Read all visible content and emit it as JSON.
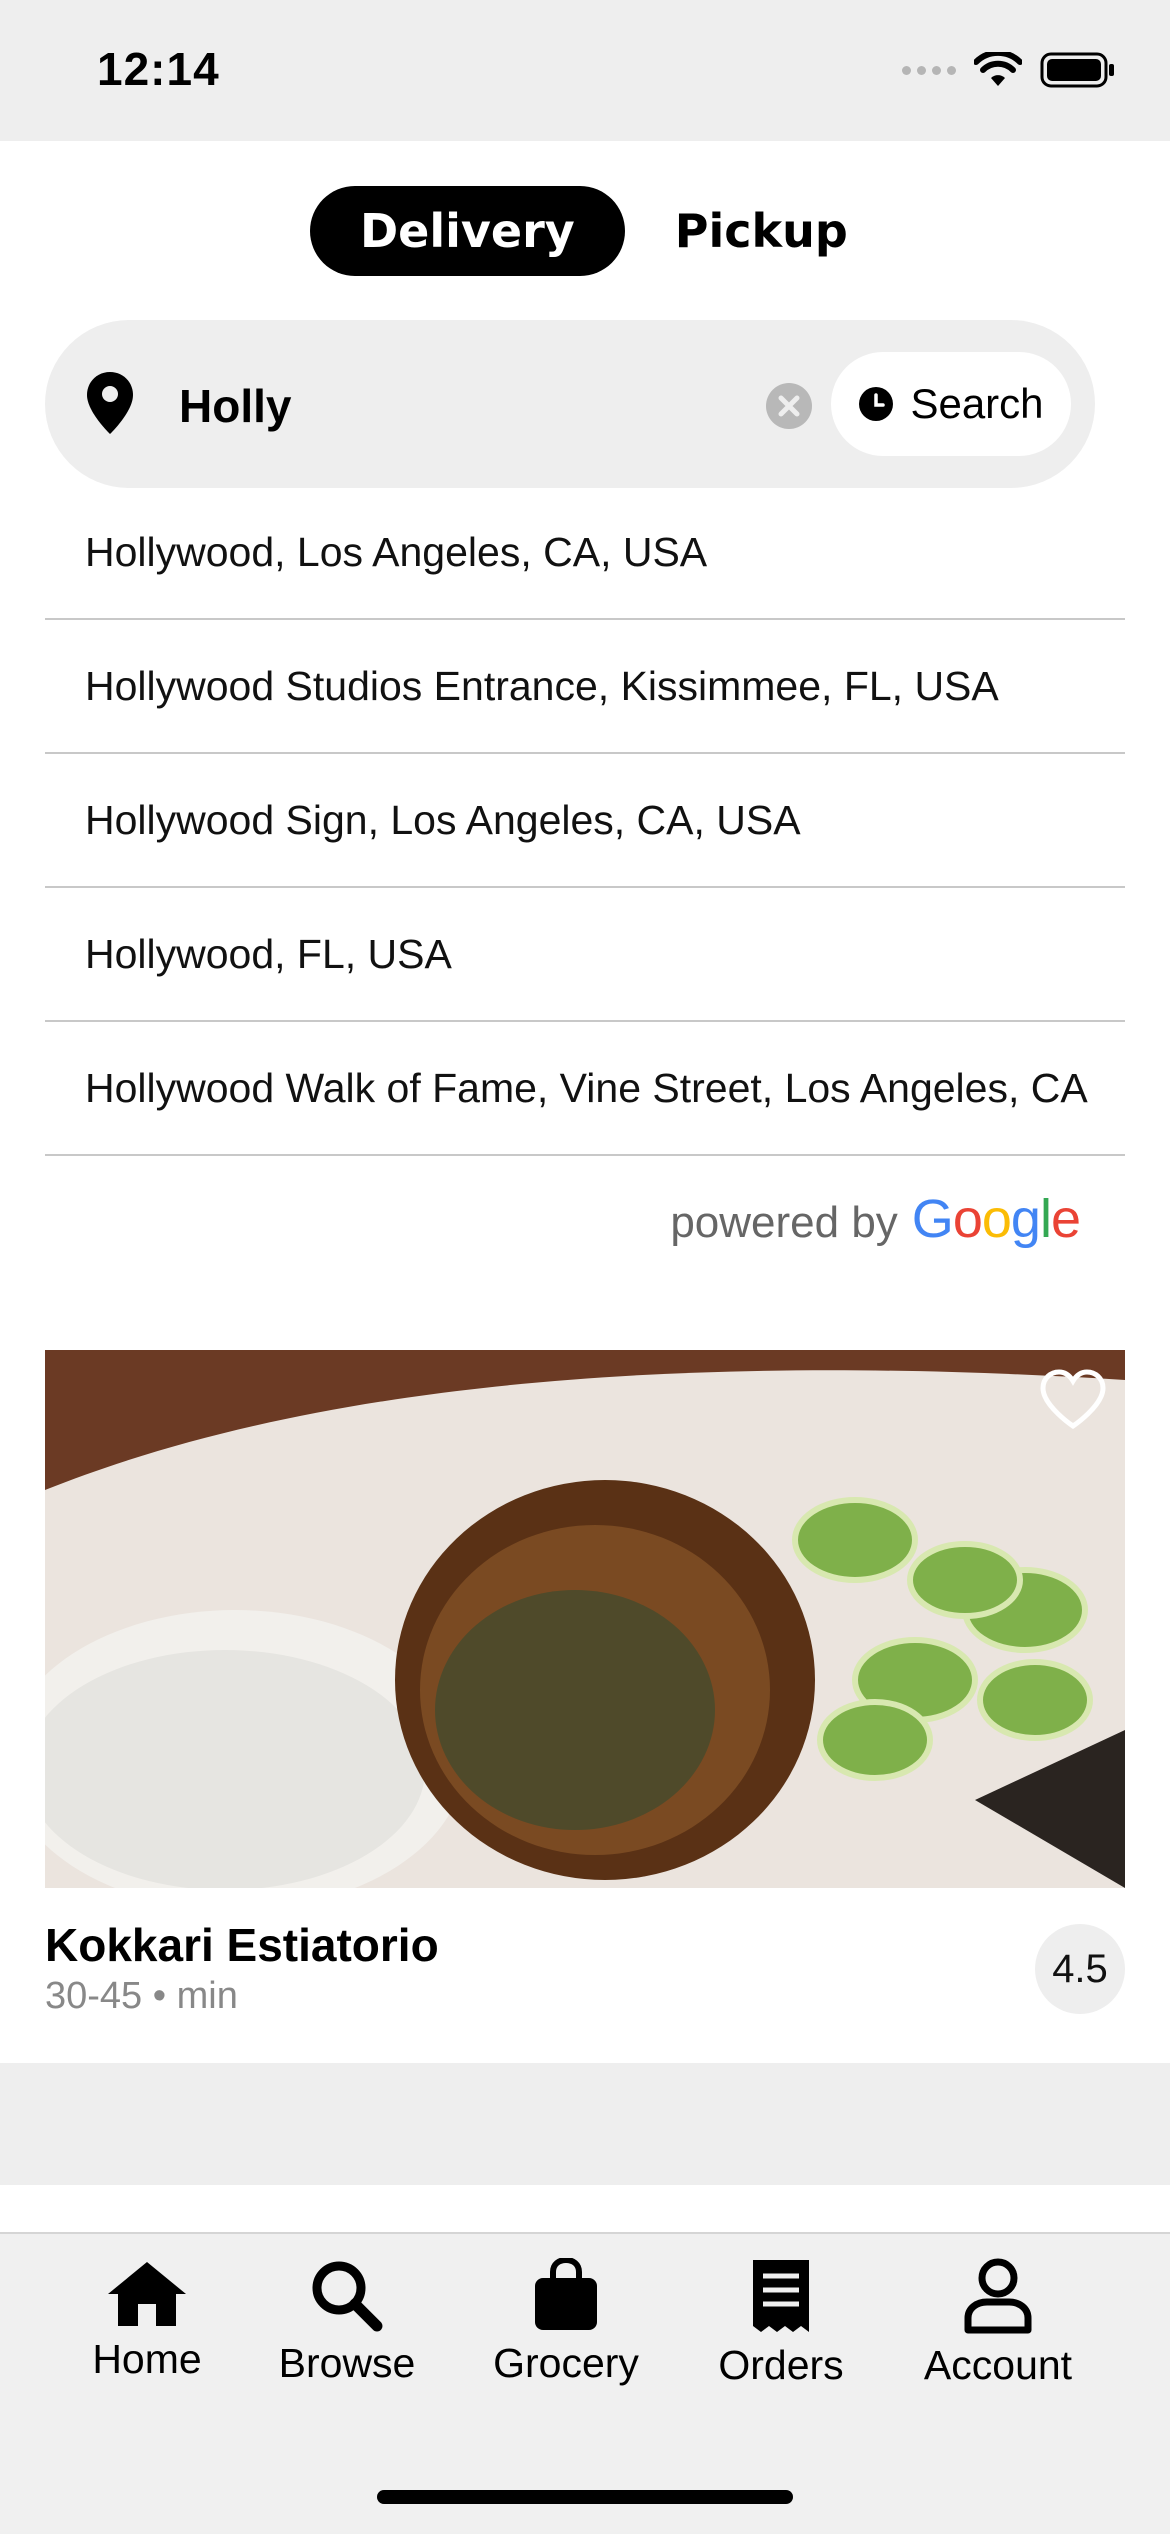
{
  "status_bar": {
    "time": "12:14"
  },
  "mode_toggle": {
    "active": "Delivery",
    "inactive": "Pickup"
  },
  "search": {
    "value": "Holly",
    "button_label": "Search"
  },
  "suggestions": [
    "Hollywood, Los Angeles, CA, USA",
    "Hollywood Studios Entrance, Kissimmee, FL, USA",
    "Hollywood Sign, Los Angeles, CA, USA",
    "Hollywood, FL, USA",
    "Hollywood Walk of Fame, Vine Street, Los Angeles, CA"
  ],
  "attribution": {
    "prefix": "powered by",
    "brand": "Google"
  },
  "restaurant": {
    "name": "Kokkari Estiatorio",
    "time_range": "30-45",
    "separator": "•",
    "unit": "min",
    "rating": "4.5"
  },
  "tabs": [
    {
      "label": "Home",
      "icon": "home-icon"
    },
    {
      "label": "Browse",
      "icon": "search-icon"
    },
    {
      "label": "Grocery",
      "icon": "bag-icon"
    },
    {
      "label": "Orders",
      "icon": "receipt-icon"
    },
    {
      "label": "Account",
      "icon": "person-icon"
    }
  ],
  "colors": {
    "accent": "#000000",
    "google_blue": "#4285F4",
    "google_red": "#EA4335",
    "google_yellow": "#FBBC05",
    "google_green": "#34A853"
  }
}
